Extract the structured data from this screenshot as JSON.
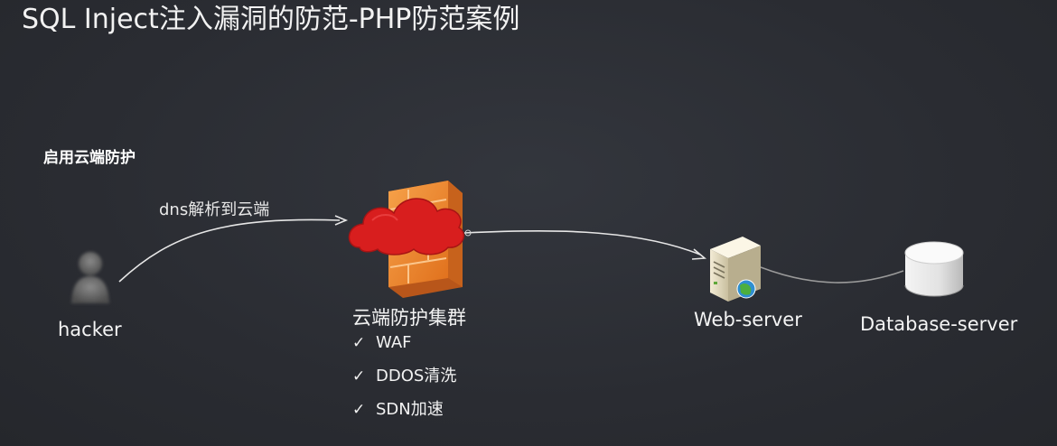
{
  "title": "SQL Inject注入漏洞的防范-PHP防范案例",
  "subtitle": "启用云端防护",
  "edge_label": "dns解析到云端",
  "nodes": {
    "hacker": "hacker",
    "cloud": "云端防护集群",
    "web_server": "Web-server",
    "database_server": "Database-server"
  },
  "features": [
    {
      "check": "✓",
      "label": "WAF"
    },
    {
      "check": "✓",
      "label": "DDOS清洗"
    },
    {
      "check": "✓",
      "label": "SDN加速"
    }
  ],
  "colors": {
    "background": "#2b2d33",
    "cloud_red": "#d81e1e",
    "firewall_orange": "#f08a2c",
    "arrow": "#e6e6e6"
  },
  "icons": {
    "hacker": "person-silhouette-icon",
    "cloud": "red-cloud-icon",
    "firewall": "firewall-icon",
    "web_server": "server-globe-icon",
    "database": "database-cylinder-icon"
  }
}
